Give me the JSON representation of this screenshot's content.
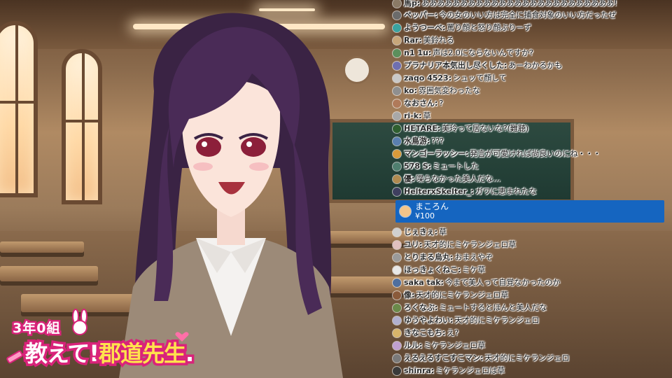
{
  "logo": {
    "class_label": "3年0組",
    "title_part1": "教えて!",
    "title_part2": "郡道先生",
    "title_dot": "."
  },
  "chat": {
    "messages": [
      {
        "user": "馬p",
        "text": "あああああああああああああああああああああああああ!",
        "avatar_color": "#8a7a66"
      },
      {
        "user": "ペッパー",
        "text": "今の女のいい方は完全に捕食対象のいい方だったぜ",
        "avatar_color": "#6b6b6b"
      },
      {
        "user": "ようつーべ",
        "text": "罵り顔と怒り顔ぶりーず",
        "avatar_color": "#3aa3a0"
      },
      {
        "user": "Rar",
        "text": "美鈴れる",
        "avatar_color": "#c8a77a"
      },
      {
        "user": "n1 1u",
        "text": "声は2.0にならないんですか?",
        "avatar_color": "#5c8f5c"
      },
      {
        "user": "プラナリア本気出し尽くした",
        "text": "あーわかるかも",
        "avatar_color": "#6f6fb0"
      },
      {
        "user": "zaqo 4523",
        "text": "シュッて顔して",
        "avatar_color": "#c9c9c9"
      },
      {
        "user": "ko",
        "text": "雰囲気変わったな",
        "avatar_color": "#8f8f8f"
      },
      {
        "user": "なおさん",
        "text": "?",
        "avatar_color": "#b07a5a"
      },
      {
        "user": "ri-k",
        "text": "草",
        "avatar_color": "#a8a8a8"
      },
      {
        "user": "HETARE",
        "text": "美玲って居ないな?(難聴)",
        "avatar_color": "#2f5f2f"
      },
      {
        "user": "水鳥游",
        "text": "???",
        "avatar_color": "#5a7fb0"
      },
      {
        "user": "マンゴーラッシー",
        "text": "発言が可愛ければ尚良いのにね・・・",
        "avatar_color": "#d99a3a"
      },
      {
        "user": "578 S",
        "text": "ミュートした",
        "avatar_color": "#4f7f6f"
      },
      {
        "user": "優",
        "text": "喋らなかった美人だな…",
        "avatar_color": "#b08a50"
      },
      {
        "user": "HelterxSkelter_",
        "text": "ガワに恵まれたな",
        "avatar_color": "#3f3f5f"
      },
      {
        "user": "じぇきぇ",
        "text": "草",
        "avatar_color": "#d0d0d0"
      },
      {
        "user": "ユリ",
        "text": "天才的にミケランジェロ草",
        "avatar_color": "#e0c0c0"
      },
      {
        "user": "とりまる烏丸",
        "text": "おまえやぞ",
        "avatar_color": "#9a9a9a"
      },
      {
        "user": "ほっきょくねこ",
        "text": "ミケ草",
        "avatar_color": "#e8e8e8"
      },
      {
        "user": "saka tak",
        "text": "今まで美人って自覚なかったのか",
        "avatar_color": "#4f6f9f"
      },
      {
        "user": "像",
        "text": "天才的にミケランジェロ草",
        "avatar_color": "#8a5a3a"
      },
      {
        "user": "ろくなぶ",
        "text": "ミュートするとほんと美人だな",
        "avatar_color": "#6a8a4a"
      },
      {
        "user": "ゆうやよわい",
        "text": "天才的にミケランジェロ",
        "avatar_color": "#b0b0d0"
      },
      {
        "user": "きなこもち",
        "text": "え?",
        "avatar_color": "#d8b46a"
      },
      {
        "user": "ルル",
        "text": "ミケランジェロ草",
        "avatar_color": "#c0a0d0"
      },
      {
        "user": "えるえるすこすこマン",
        "text": "天才的にミケランジェロ",
        "avatar_color": "#7a7a7a"
      },
      {
        "user": "shinra",
        "text": "ミケランジェロは草",
        "avatar_color": "#3a3a3a"
      }
    ],
    "superchat": {
      "user": "まころん",
      "amount": "¥100",
      "color": "#1565c0"
    }
  }
}
